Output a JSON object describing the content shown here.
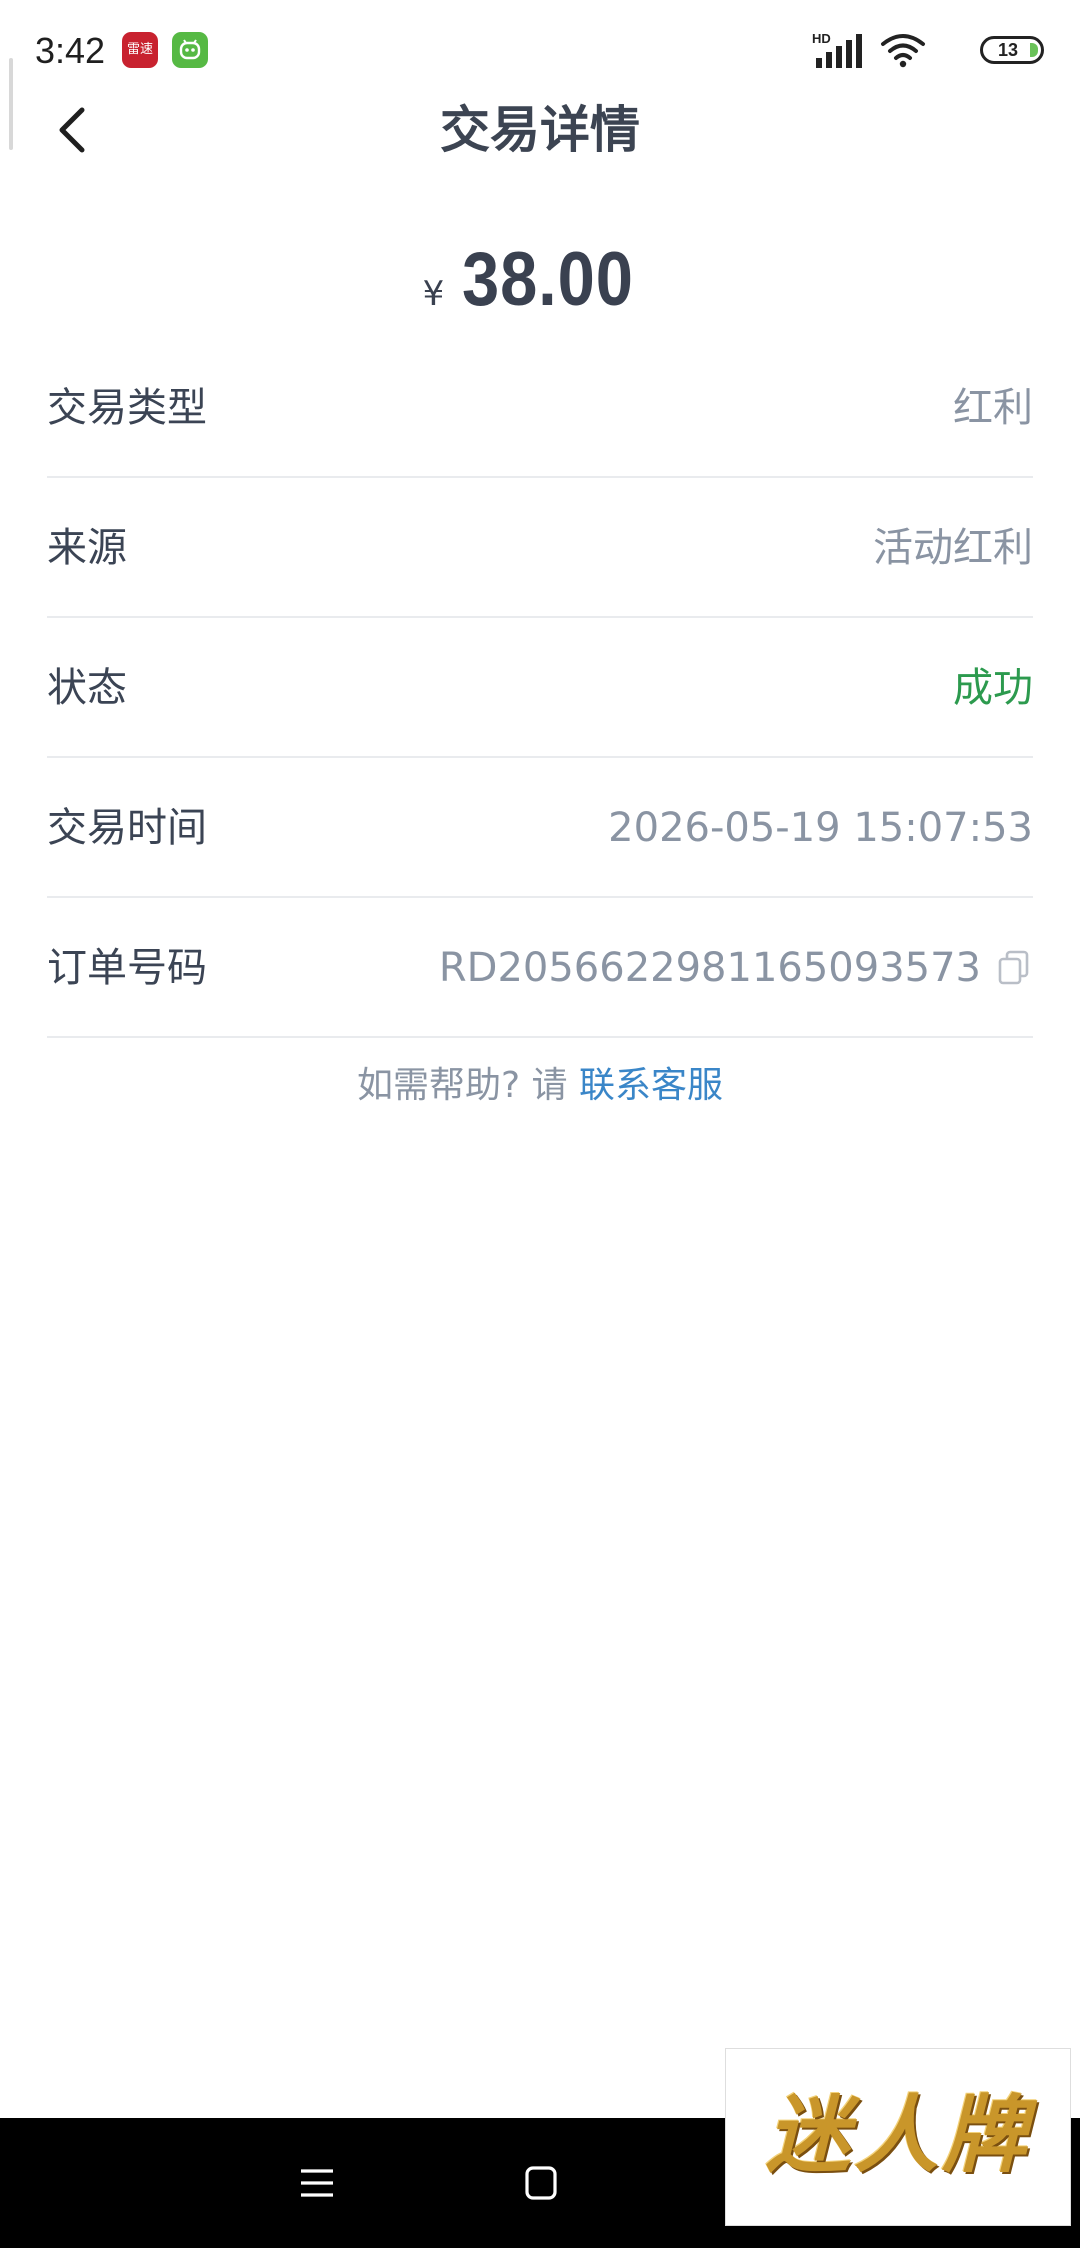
{
  "status_bar": {
    "time": "3:42",
    "app_badge_label": "雷速",
    "network_label": "HD",
    "battery": "13"
  },
  "header": {
    "title": "交易详情"
  },
  "amount": {
    "currency": "¥",
    "value": "38.00"
  },
  "details": {
    "type": {
      "label": "交易类型",
      "value": "红利"
    },
    "source": {
      "label": "来源",
      "value": "活动红利"
    },
    "status": {
      "label": "状态",
      "value": "成功"
    },
    "time": {
      "label": "交易时间",
      "value": "2026-05-19 15:07:53"
    },
    "order": {
      "label": "订单号码",
      "value": "RD2056622981165093573"
    }
  },
  "help": {
    "prefix": "如需帮助? 请 ",
    "link": "联系客服"
  },
  "watermark": {
    "text": "迷人牌"
  },
  "colors": {
    "status_success": "#2c9a4e",
    "link": "#3a86c8",
    "text_primary": "#3b4454",
    "text_secondary": "#8a94a3"
  }
}
